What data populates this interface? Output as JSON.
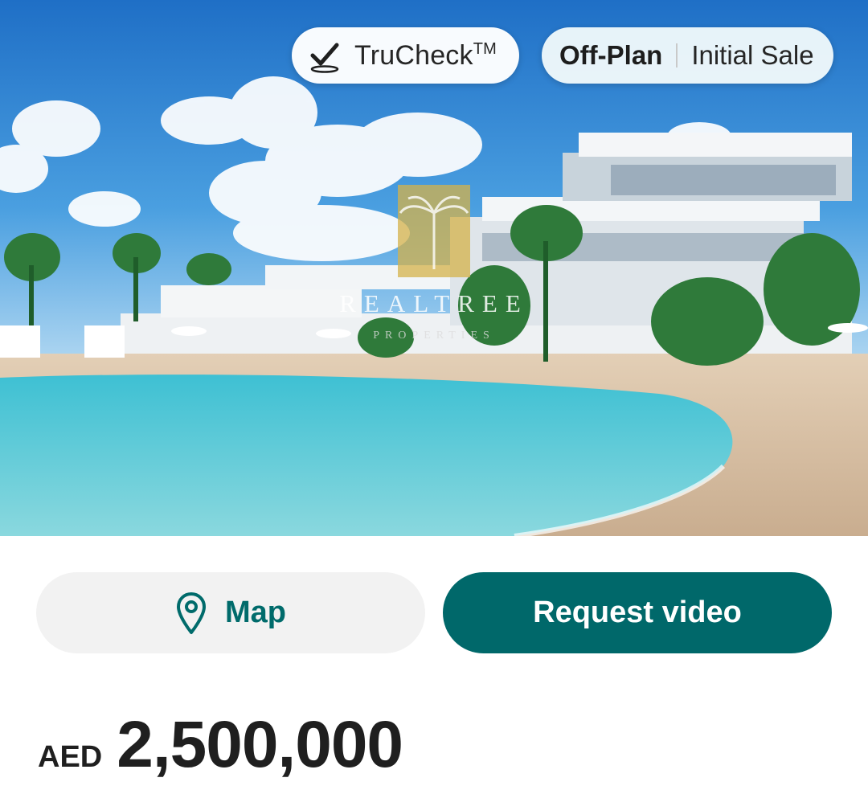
{
  "hero": {
    "trucheck_label": "TruCheck",
    "trucheck_mark": "TM",
    "status_primary": "Off-Plan",
    "status_secondary": "Initial Sale",
    "watermark_brand": "REALTREE",
    "watermark_sub": "PROPERTIES"
  },
  "actions": {
    "map_label": "Map",
    "video_label": "Request video"
  },
  "price": {
    "currency": "AED",
    "amount": "2,500,000"
  },
  "icons": {
    "trucheck": "check-badge-icon",
    "map": "map-pin-icon"
  },
  "colors": {
    "accent": "#00686a",
    "map_text": "#006b6b"
  }
}
